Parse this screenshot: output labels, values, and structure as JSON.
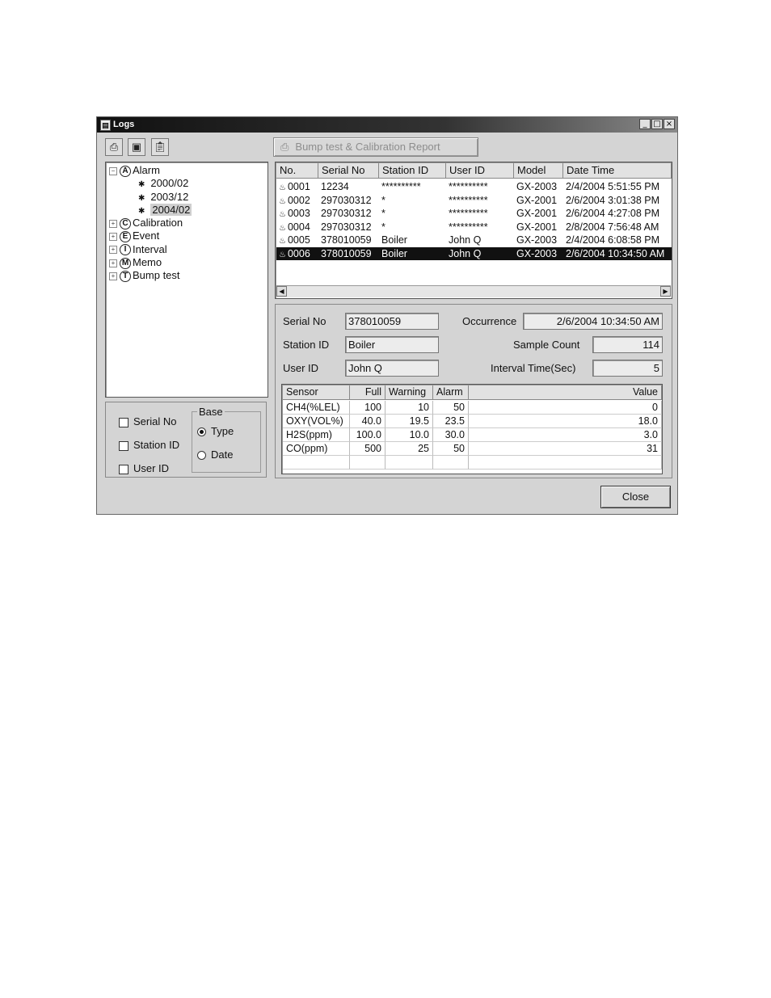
{
  "window": {
    "title": "Logs",
    "controls": [
      "_",
      "□",
      "×"
    ]
  },
  "toolbar": {
    "print_icon": "printer-icon",
    "save_icon": "floppy-disk-icon",
    "clipboard_icon": "clipboard-icon",
    "report_button": "Bump test & Calibration Report"
  },
  "tree": {
    "alarm": {
      "letter": "A",
      "label": "Alarm",
      "children": [
        "2000/02",
        "2003/12",
        "2004/02"
      ],
      "selected": "2004/02"
    },
    "others": [
      {
        "letter": "C",
        "label": "Calibration"
      },
      {
        "letter": "E",
        "label": "Event"
      },
      {
        "letter": "I",
        "label": "Interval"
      },
      {
        "letter": "M",
        "label": "Memo"
      },
      {
        "letter": "T",
        "label": "Bump test"
      }
    ]
  },
  "filters": {
    "serial_no": "Serial No",
    "station_id": "Station ID",
    "user_id": "User ID",
    "base_legend": "Base",
    "type": "Type",
    "date": "Date",
    "base_selected": "Type"
  },
  "log_list": {
    "columns": [
      "No.",
      "Serial No",
      "Station ID",
      "User ID",
      "Model",
      "Date Time"
    ],
    "rows": [
      [
        "0001",
        "12234",
        "**********",
        "**********",
        "GX-2003",
        "2/4/2004 5:51:55 PM"
      ],
      [
        "0002",
        "297030312",
        "*",
        "**********",
        "GX-2001",
        "2/6/2004 3:01:38 PM"
      ],
      [
        "0003",
        "297030312",
        "*",
        "**********",
        "GX-2001",
        "2/6/2004 4:27:08 PM"
      ],
      [
        "0004",
        "297030312",
        "*",
        "**********",
        "GX-2001",
        "2/8/2004 7:56:48 AM"
      ],
      [
        "0005",
        "378010059",
        "Boiler",
        "John Q",
        "GX-2003",
        "2/4/2004 6:08:58 PM"
      ],
      [
        "0006",
        "378010059",
        "Boiler",
        "John Q",
        "GX-2003",
        "2/6/2004 10:34:50 AM"
      ]
    ],
    "selected_index": 5
  },
  "detail": {
    "serial_no_label": "Serial No",
    "serial_no": "378010059",
    "station_id_label": "Station ID",
    "station_id": "Boiler",
    "user_id_label": "User ID",
    "user_id": "John Q",
    "occurrence_label": "Occurrence",
    "occurrence": "2/6/2004 10:34:50 AM",
    "sample_count_label": "Sample Count",
    "sample_count": "114",
    "interval_label": "Interval Time(Sec)",
    "interval": "5"
  },
  "sensors": {
    "columns": [
      "Sensor",
      "Full",
      "Warning",
      "Alarm",
      "Value"
    ],
    "rows": [
      [
        "CH4(%LEL)",
        "100",
        "10",
        "50",
        "0"
      ],
      [
        "OXY(VOL%)",
        "40.0",
        "19.5",
        "23.5",
        "18.0"
      ],
      [
        "H2S(ppm)",
        "100.0",
        "10.0",
        "30.0",
        "3.0"
      ],
      [
        "CO(ppm)",
        "500",
        "25",
        "50",
        "31"
      ]
    ]
  },
  "close_button": "Close"
}
